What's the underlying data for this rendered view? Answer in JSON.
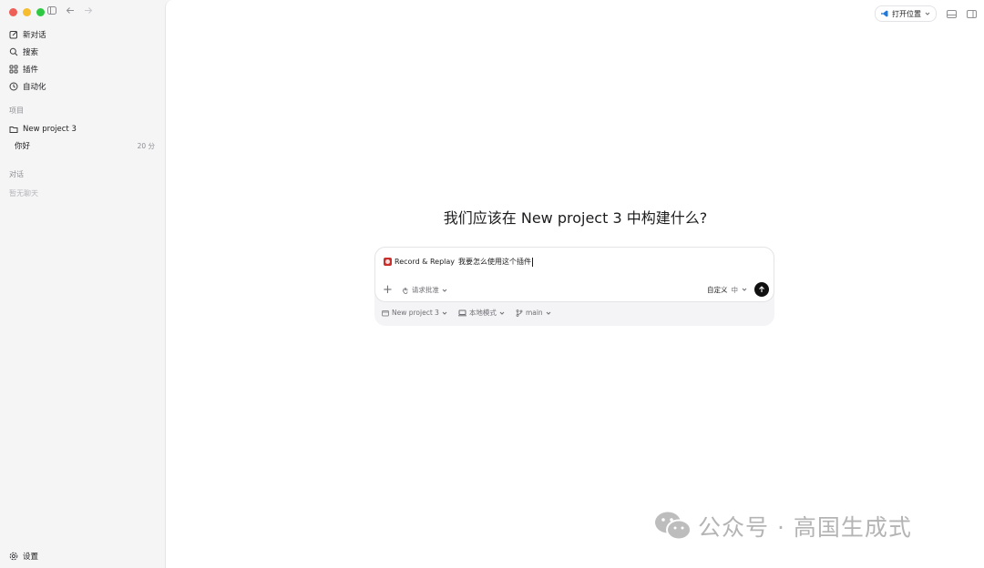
{
  "sidebar": {
    "nav": [
      {
        "label": "新对话",
        "icon": "compose-icon"
      },
      {
        "label": "搜索",
        "icon": "search-icon"
      },
      {
        "label": "插件",
        "icon": "grid-icon"
      },
      {
        "label": "自动化",
        "icon": "clock-icon"
      }
    ],
    "projects_label": "项目",
    "project_name": "New project 3",
    "thread_title": "你好",
    "thread_time": "20 分",
    "chats_label": "对话",
    "chats_empty": "暂无聊天",
    "settings_label": "设置"
  },
  "topbar": {
    "open_label": "打开位置"
  },
  "main": {
    "headline": "我们应该在 New project 3 中构建什么?",
    "composer": {
      "plugin_name": "Record & Replay",
      "prompt_text": "我要怎么使用这个插件",
      "approval_label": "请求批准",
      "model_label": "自定义",
      "model_level": "中"
    },
    "context": {
      "project": "New project 3",
      "mode": "本地模式",
      "branch": "main"
    }
  },
  "watermark": "公众号 · 高国生成式",
  "colors": {
    "send_button": "#111111",
    "sidebar_bg": "#f5f5f6",
    "main_bg": "#ffffff"
  }
}
